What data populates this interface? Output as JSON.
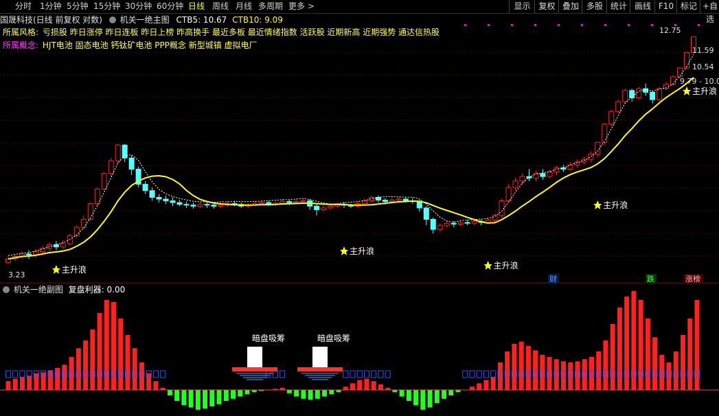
{
  "toolbar": {
    "periods": [
      "分时",
      "1分钟",
      "5分钟",
      "15分钟",
      "30分钟",
      "60分钟",
      "日线",
      "周线",
      "月线",
      "多周期",
      "更多 >"
    ],
    "active_index": 6,
    "right_buttons": [
      "显示",
      "复权",
      "叠加",
      "多股",
      "统计",
      "画线",
      "F10",
      "标记",
      "+自选"
    ]
  },
  "main_chart": {
    "title_stock": "国晟科技(日线 前复权 对数)",
    "indicator_name": "机关一绝主图",
    "ctb5": "CTB5: 10.67",
    "ctb10": "CTB10: 9.09",
    "style_label": "所属风格:",
    "style_tags": "亏损股 昨日涨停 昨日连板 昨日上榜 昨高换手 最近多板 最近情绪指数 活跃股 近期新高 近期强势 通达信热股",
    "concept_label": "所属概念:",
    "concept_tags": "HJT电池 固态电池 钙钛矿电池 PPP概念 新型城镇 虚拟电厂",
    "signal_label": "主升浪",
    "price_labels": [
      "12.75",
      "11.59",
      "10.54",
      "9.79 - 10.0"
    ],
    "low_label": "3.23",
    "markers": [
      "财",
      "跌",
      "涨榜"
    ]
  },
  "sub_chart": {
    "indicator_name": "机关一绝副图",
    "field": "复盘利器: 0.00",
    "annotation": "暗盘吸筹"
  },
  "colors": {
    "up": "#ff2020",
    "down": "#54ffff",
    "ma": "#ffff00",
    "green_bar": "#22ff22",
    "purple": "#ff00ff"
  },
  "chart_data": {
    "type": "candlestick",
    "scale": "log",
    "ylim": [
      3.0,
      13.5
    ],
    "candles": [
      [
        3.23,
        3.3,
        3.2,
        3.35
      ],
      [
        3.3,
        3.35,
        3.26,
        3.4
      ],
      [
        3.35,
        3.4,
        3.3,
        3.45
      ],
      [
        3.4,
        3.38,
        3.3,
        3.48
      ],
      [
        3.38,
        3.45,
        3.32,
        3.5
      ],
      [
        3.45,
        3.52,
        3.4,
        3.58
      ],
      [
        3.52,
        3.6,
        3.45,
        3.65
      ],
      [
        3.6,
        3.55,
        3.48,
        3.68
      ],
      [
        3.55,
        3.62,
        3.5,
        3.7
      ],
      [
        3.62,
        3.8,
        3.58,
        3.85
      ],
      [
        3.8,
        4.0,
        3.75,
        4.05
      ],
      [
        4.0,
        4.2,
        3.95,
        4.3
      ],
      [
        4.2,
        4.62,
        4.15,
        4.65
      ],
      [
        4.62,
        5.05,
        4.55,
        5.1
      ],
      [
        5.05,
        5.55,
        5.0,
        5.6
      ],
      [
        5.55,
        6.0,
        5.45,
        6.1
      ],
      [
        6.0,
        6.6,
        5.9,
        6.65
      ],
      [
        6.6,
        6.1,
        5.95,
        6.65
      ],
      [
        6.1,
        5.7,
        5.5,
        6.2
      ],
      [
        5.7,
        5.2,
        5.1,
        5.8
      ],
      [
        5.2,
        5.0,
        4.9,
        5.3
      ],
      [
        5.0,
        4.8,
        4.7,
        5.1
      ],
      [
        4.8,
        4.75,
        4.65,
        4.9
      ],
      [
        4.75,
        4.7,
        4.6,
        4.85
      ],
      [
        4.7,
        4.65,
        4.55,
        4.8
      ],
      [
        4.65,
        4.6,
        4.55,
        4.72
      ],
      [
        4.6,
        4.58,
        4.5,
        4.68
      ],
      [
        4.58,
        4.55,
        4.48,
        4.65
      ],
      [
        4.55,
        4.6,
        4.5,
        4.66
      ],
      [
        4.6,
        4.58,
        4.5,
        4.65
      ],
      [
        4.58,
        4.55,
        4.48,
        4.62
      ],
      [
        4.55,
        4.58,
        4.5,
        4.64
      ],
      [
        4.58,
        4.62,
        4.52,
        4.68
      ],
      [
        4.62,
        4.6,
        4.55,
        4.7
      ],
      [
        4.6,
        4.55,
        4.5,
        4.65
      ],
      [
        4.55,
        4.58,
        4.5,
        4.63
      ],
      [
        4.58,
        4.62,
        4.55,
        4.7
      ],
      [
        4.62,
        4.65,
        4.58,
        4.72
      ],
      [
        4.65,
        4.6,
        4.55,
        4.7
      ],
      [
        4.6,
        4.63,
        4.55,
        4.68
      ],
      [
        4.63,
        4.68,
        4.6,
        4.75
      ],
      [
        4.68,
        4.65,
        4.58,
        4.72
      ],
      [
        4.65,
        4.68,
        4.6,
        4.75
      ],
      [
        4.68,
        4.7,
        4.62,
        4.78
      ],
      [
        4.7,
        4.55,
        4.45,
        4.75
      ],
      [
        4.55,
        4.45,
        4.3,
        4.6
      ],
      [
        4.45,
        4.5,
        4.4,
        4.58
      ],
      [
        4.5,
        4.55,
        4.45,
        4.62
      ],
      [
        4.55,
        4.6,
        4.5,
        4.65
      ],
      [
        4.6,
        4.58,
        4.5,
        4.66
      ],
      [
        4.58,
        4.55,
        4.5,
        4.62
      ],
      [
        4.55,
        4.62,
        4.5,
        4.68
      ],
      [
        4.62,
        4.7,
        4.58,
        4.78
      ],
      [
        4.7,
        4.8,
        4.65,
        4.85
      ],
      [
        4.8,
        4.72,
        4.65,
        4.85
      ],
      [
        4.72,
        4.68,
        4.6,
        4.78
      ],
      [
        4.68,
        4.72,
        4.62,
        4.8
      ],
      [
        4.72,
        4.75,
        4.65,
        4.82
      ],
      [
        4.75,
        4.7,
        4.65,
        4.8
      ],
      [
        4.7,
        4.68,
        4.62,
        4.78
      ],
      [
        4.68,
        4.5,
        4.4,
        4.72
      ],
      [
        4.5,
        4.2,
        4.05,
        4.55
      ],
      [
        4.2,
        3.95,
        3.85,
        4.25
      ],
      [
        3.95,
        4.05,
        3.9,
        4.1
      ],
      [
        4.05,
        4.1,
        4.0,
        4.15
      ],
      [
        4.1,
        4.08,
        4.0,
        4.15
      ],
      [
        4.08,
        4.12,
        4.03,
        4.18
      ],
      [
        4.12,
        4.1,
        4.05,
        4.18
      ],
      [
        4.1,
        4.15,
        4.05,
        4.2
      ],
      [
        4.15,
        4.12,
        4.05,
        4.2
      ],
      [
        4.12,
        4.18,
        4.08,
        4.25
      ],
      [
        4.18,
        4.3,
        4.12,
        4.35
      ],
      [
        4.3,
        4.7,
        4.25,
        4.75
      ],
      [
        4.7,
        5.1,
        4.65,
        5.2
      ],
      [
        5.1,
        5.3,
        5.0,
        5.4
      ],
      [
        5.3,
        5.45,
        5.2,
        5.55
      ],
      [
        5.45,
        5.4,
        5.3,
        5.7
      ],
      [
        5.4,
        5.55,
        5.3,
        5.65
      ],
      [
        5.55,
        5.45,
        5.35,
        5.7
      ],
      [
        5.45,
        5.6,
        5.4,
        5.68
      ],
      [
        5.6,
        5.75,
        5.5,
        5.82
      ],
      [
        5.75,
        5.7,
        5.6,
        5.85
      ],
      [
        5.7,
        5.85,
        5.65,
        5.95
      ],
      [
        5.85,
        5.95,
        5.75,
        6.05
      ],
      [
        5.95,
        6.05,
        5.85,
        6.15
      ],
      [
        6.05,
        6.25,
        5.95,
        6.35
      ],
      [
        6.25,
        6.7,
        6.15,
        6.75
      ],
      [
        6.7,
        7.5,
        6.6,
        7.55
      ],
      [
        7.5,
        8.1,
        7.4,
        8.2
      ],
      [
        8.1,
        8.6,
        8.0,
        8.7
      ],
      [
        8.6,
        9.2,
        8.5,
        9.3
      ],
      [
        9.2,
        8.8,
        8.6,
        9.3
      ],
      [
        8.8,
        9.3,
        8.7,
        9.4
      ],
      [
        9.3,
        9.1,
        8.9,
        9.6
      ],
      [
        9.1,
        8.7,
        8.5,
        9.2
      ],
      [
        8.7,
        9.3,
        8.6,
        9.4
      ],
      [
        9.3,
        9.55,
        9.2,
        9.7
      ],
      [
        9.55,
        10.0,
        9.45,
        10.1
      ],
      [
        10.0,
        10.55,
        9.9,
        10.6
      ],
      [
        10.55,
        11.6,
        10.45,
        11.65
      ],
      [
        11.6,
        12.75,
        11.5,
        12.8
      ]
    ],
    "sub_bars": [
      0.8,
      1.0,
      1.2,
      1.3,
      1.5,
      1.6,
      1.8,
      2.0,
      2.3,
      3.0,
      3.8,
      4.5,
      5.5,
      7.0,
      8.2,
      8.0,
      6.5,
      5.0,
      3.8,
      2.5,
      1.5,
      0.8,
      0.2,
      -0.5,
      -1.0,
      -1.4,
      -1.6,
      -1.8,
      -1.7,
      -1.5,
      -1.3,
      -1.0,
      -0.8,
      -0.6,
      -0.4,
      -0.2,
      -0.1,
      0.0,
      0.1,
      0.2,
      -0.3,
      -0.6,
      -0.8,
      -0.9,
      -0.8,
      -0.6,
      -0.4,
      -0.2,
      0.3,
      0.6,
      0.9,
      1.0,
      0.8,
      0.5,
      0.2,
      -0.2,
      -0.6,
      -1.0,
      -1.4,
      -1.8,
      -1.6,
      -1.2,
      -0.8,
      -0.5,
      -0.2,
      0.0,
      0.3,
      0.6,
      0.9,
      1.2,
      2.5,
      3.5,
      4.2,
      4.4,
      4.0,
      3.6,
      3.2,
      3.0,
      2.8,
      2.6,
      2.5,
      2.6,
      2.8,
      3.0,
      3.5,
      4.5,
      6.0,
      7.5,
      8.5,
      9.0,
      8.2,
      6.5,
      4.8,
      3.2,
      2.5,
      3.5,
      5.0,
      6.5,
      8.2
    ]
  }
}
